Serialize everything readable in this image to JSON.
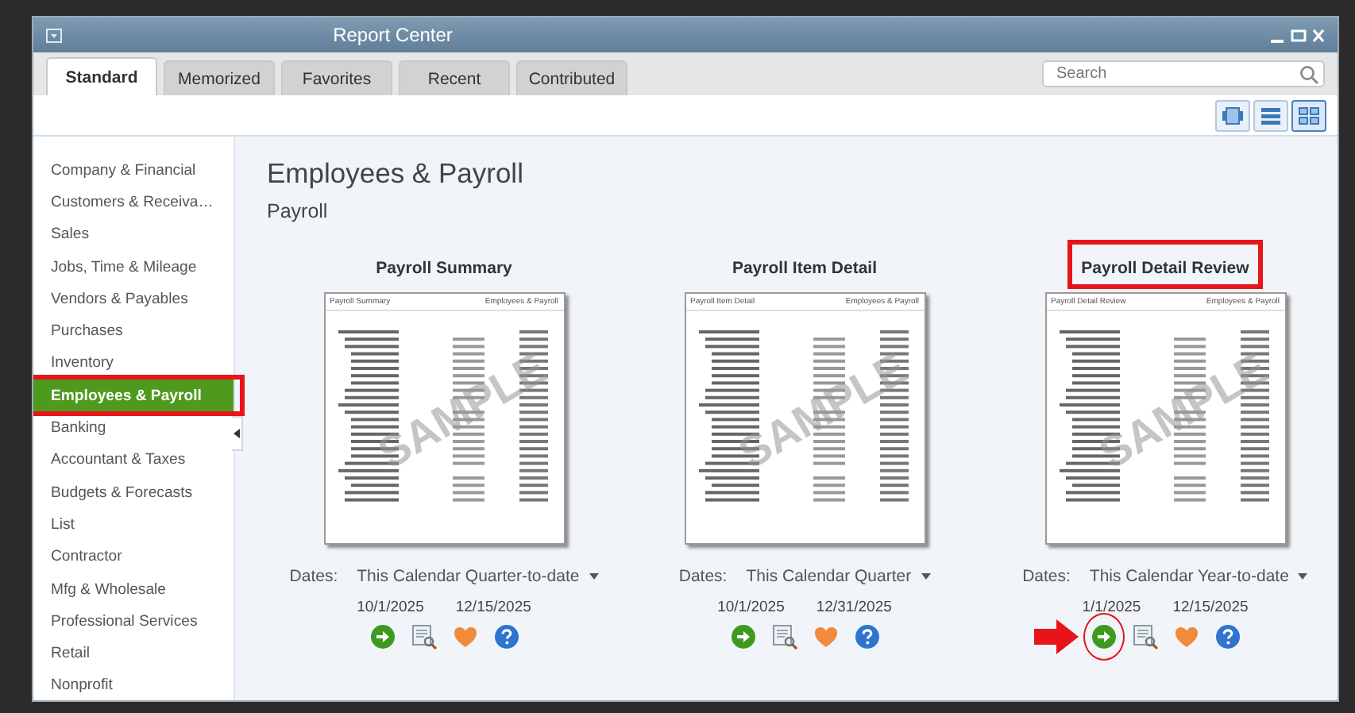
{
  "window": {
    "title": "Report Center"
  },
  "tabs": [
    {
      "label": "Standard",
      "selected": true
    },
    {
      "label": "Memorized",
      "selected": false
    },
    {
      "label": "Favorites",
      "selected": false
    },
    {
      "label": "Recent",
      "selected": false
    },
    {
      "label": "Contributed",
      "selected": false
    }
  ],
  "search": {
    "placeholder": "Search"
  },
  "views": [
    {
      "kind": "carousel",
      "selected": false
    },
    {
      "kind": "list",
      "selected": false
    },
    {
      "kind": "grid",
      "selected": true
    }
  ],
  "sidebar": {
    "items": [
      {
        "label": "Company & Financial",
        "selected": false,
        "highlighted": false
      },
      {
        "label": "Customers & Receiva…",
        "selected": false,
        "highlighted": false
      },
      {
        "label": "Sales",
        "selected": false,
        "highlighted": false
      },
      {
        "label": "Jobs, Time & Mileage",
        "selected": false,
        "highlighted": false
      },
      {
        "label": "Vendors & Payables",
        "selected": false,
        "highlighted": false
      },
      {
        "label": "Purchases",
        "selected": false,
        "highlighted": false
      },
      {
        "label": "Inventory",
        "selected": false,
        "highlighted": false
      },
      {
        "label": "Employees & Payroll",
        "selected": true,
        "highlighted": true
      },
      {
        "label": "Banking",
        "selected": false,
        "highlighted": false
      },
      {
        "label": "Accountant & Taxes",
        "selected": false,
        "highlighted": false
      },
      {
        "label": "Budgets & Forecasts",
        "selected": false,
        "highlighted": false
      },
      {
        "label": "List",
        "selected": false,
        "highlighted": false
      },
      {
        "label": "Contractor",
        "selected": false,
        "highlighted": false
      },
      {
        "label": "Mfg & Wholesale",
        "selected": false,
        "highlighted": false
      },
      {
        "label": "Professional Services",
        "selected": false,
        "highlighted": false
      },
      {
        "label": "Retail",
        "selected": false,
        "highlighted": false
      },
      {
        "label": "Nonprofit",
        "selected": false,
        "highlighted": false
      }
    ]
  },
  "main": {
    "heading": "Employees & Payroll",
    "subheading": "Payroll"
  },
  "reports": [
    {
      "title": "Payroll Summary",
      "title_highlighted": false,
      "preview_left": "Payroll Summary",
      "preview_right": "Employees & Payroll",
      "stamp": "SAMPLE",
      "dates_label": "Dates:",
      "range": "This Calendar Quarter-to-date",
      "from": "10/1/2025",
      "to": "12/15/2025",
      "run_marked": false
    },
    {
      "title": "Payroll Item Detail",
      "title_highlighted": false,
      "preview_left": "Payroll Item Detail",
      "preview_right": "Employees & Payroll",
      "stamp": "SAMPLE",
      "dates_label": "Dates:",
      "range": "This Calendar Quarter",
      "from": "10/1/2025",
      "to": "12/31/2025",
      "run_marked": false
    },
    {
      "title": "Payroll Detail Review",
      "title_highlighted": true,
      "preview_left": "Payroll Detail Review",
      "preview_right": "Employees & Payroll",
      "stamp": "SAMPLE",
      "dates_label": "Dates:",
      "range": "This Calendar Year-to-date",
      "from": "1/1/2025",
      "to": "12/15/2025",
      "run_marked": true
    }
  ]
}
